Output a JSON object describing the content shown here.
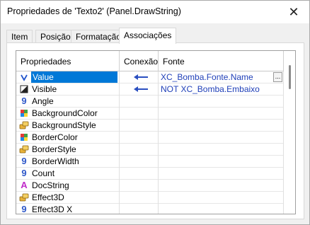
{
  "window": {
    "title": "Propriedades de 'Texto2' (Panel.DrawString)"
  },
  "tabs": [
    {
      "label": "Item",
      "active": false
    },
    {
      "label": "Posição",
      "active": false
    },
    {
      "label": "Formatação",
      "active": false
    },
    {
      "label": "Associações",
      "active": true
    }
  ],
  "grid": {
    "headers": {
      "property": "Propriedades",
      "connection": "Conexão",
      "source": "Fonte"
    },
    "rows": [
      {
        "name": "Value",
        "icon": "variant-icon",
        "selected": true,
        "linked": true,
        "source": "XC_Bomba.Fonte.Name"
      },
      {
        "name": "Visible",
        "icon": "boolean-icon",
        "selected": false,
        "linked": true,
        "source": "NOT XC_Bomba.Embaixo"
      },
      {
        "name": "Angle",
        "icon": "numeric-icon",
        "selected": false,
        "linked": false,
        "source": ""
      },
      {
        "name": "BackgroundColor",
        "icon": "color-icon",
        "selected": false,
        "linked": false,
        "source": ""
      },
      {
        "name": "BackgroundStyle",
        "icon": "enum-icon",
        "selected": false,
        "linked": false,
        "source": ""
      },
      {
        "name": "BorderColor",
        "icon": "color-icon",
        "selected": false,
        "linked": false,
        "source": ""
      },
      {
        "name": "BorderStyle",
        "icon": "enum-icon",
        "selected": false,
        "linked": false,
        "source": ""
      },
      {
        "name": "BorderWidth",
        "icon": "numeric-icon",
        "selected": false,
        "linked": false,
        "source": ""
      },
      {
        "name": "Count",
        "icon": "numeric-icon",
        "selected": false,
        "linked": false,
        "source": ""
      },
      {
        "name": "DocString",
        "icon": "string-icon",
        "selected": false,
        "linked": false,
        "source": ""
      },
      {
        "name": "Effect3D",
        "icon": "enum-icon",
        "selected": false,
        "linked": false,
        "source": ""
      },
      {
        "name": "Effect3D_X",
        "icon": "numeric-icon",
        "selected": false,
        "linked": false,
        "source": ""
      }
    ]
  },
  "colors": {
    "selection": "#0078d7",
    "link_text": "#1f3fb8",
    "arrow": "#2a4fc0"
  }
}
